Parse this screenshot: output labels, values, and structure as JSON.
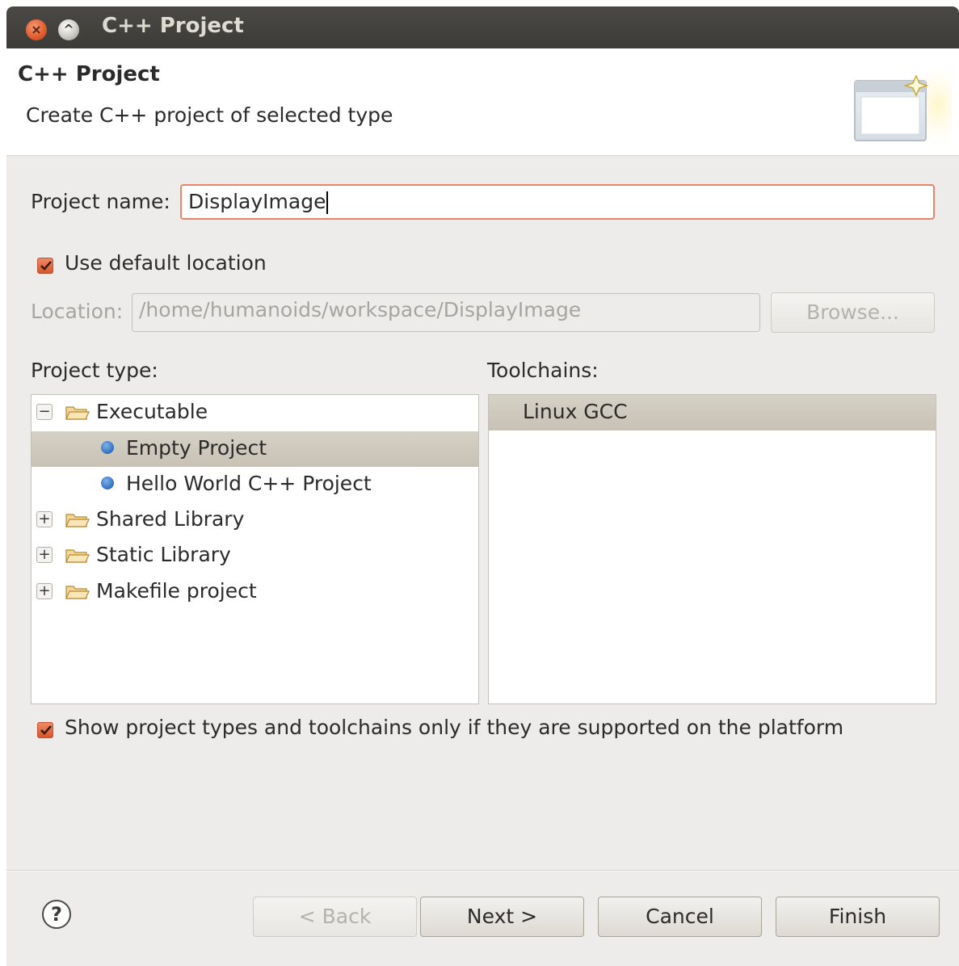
{
  "window": {
    "title": "C++ Project",
    "close_glyph": "×",
    "maximize_glyph": "^"
  },
  "header": {
    "title": "C++ Project",
    "description": "Create C++ project of selected type",
    "icon": "new-project-wizard-icon"
  },
  "form": {
    "project_name_label": "Project name:",
    "project_name_value": "DisplayImage",
    "use_default_location_label": "Use default location",
    "use_default_location_checked": true,
    "location_label": "Location:",
    "location_value": "/home/humanoids/workspace/DisplayImage",
    "browse_label": "Browse..."
  },
  "project_type": {
    "label": "Project type:",
    "items": [
      {
        "label": "Executable",
        "kind": "folder",
        "expander": "−",
        "expanded": true
      },
      {
        "label": "Empty Project",
        "kind": "leaf",
        "selected": true
      },
      {
        "label": "Hello World C++ Project",
        "kind": "leaf"
      },
      {
        "label": "Shared Library",
        "kind": "folder",
        "expander": "+",
        "expanded": false
      },
      {
        "label": "Static Library",
        "kind": "folder",
        "expander": "+",
        "expanded": false
      },
      {
        "label": "Makefile project",
        "kind": "folder",
        "expander": "+",
        "expanded": false
      }
    ]
  },
  "toolchains": {
    "label": "Toolchains:",
    "items": [
      {
        "label": "Linux GCC",
        "selected": true
      }
    ]
  },
  "show_supported": {
    "label": "Show project types and toolchains only if they are supported on the platform",
    "checked": true
  },
  "footer": {
    "help_glyph": "?",
    "back_label": "< Back",
    "next_label": "Next >",
    "cancel_label": "Cancel",
    "finish_label": "Finish"
  },
  "colors": {
    "accent": "#e05a2a",
    "selection": "#c8c2b5",
    "window_bg": "#edeceb",
    "titlebar": "#3c3b37"
  }
}
